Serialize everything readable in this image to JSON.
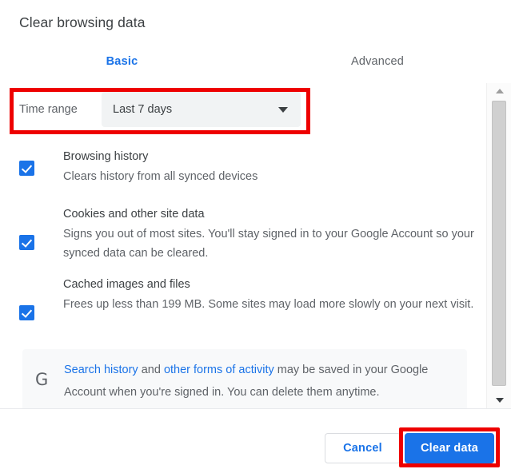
{
  "dialog": {
    "title": "Clear browsing data"
  },
  "tabs": [
    {
      "label": "Basic",
      "active": true
    },
    {
      "label": "Advanced",
      "active": false
    }
  ],
  "time_range": {
    "label": "Time range",
    "selected": "Last 7 days",
    "caret_icon": "chevron-down-icon"
  },
  "options": [
    {
      "title": "Browsing history",
      "description": "Clears history from all synced devices",
      "checked": true
    },
    {
      "title": "Cookies and other site data",
      "description": "Signs you out of most sites. You'll stay signed in to your Google Account so your synced data can be cleared.",
      "checked": true
    },
    {
      "title": "Cached images and files",
      "description": "Frees up less than 199 MB. Some sites may load more slowly on your next visit.",
      "checked": true
    }
  ],
  "notice": {
    "icon": "google-g-icon",
    "link1": "Search history",
    "mid": " and ",
    "link2": "other forms of activity",
    "rest": " may be saved in your Google Account when you're signed in. You can delete them anytime."
  },
  "scrollbar": {
    "up_icon": "triangle-up-icon",
    "down_icon": "triangle-down-icon"
  },
  "footer": {
    "cancel_label": "Cancel",
    "clear_label": "Clear data"
  },
  "colors": {
    "accent": "#1a73e8",
    "annotation": "#ee0000",
    "text_primary": "#3c4043",
    "text_secondary": "#5f6368",
    "field_bg": "#f1f3f4",
    "notice_bg": "#f8f9fa"
  }
}
